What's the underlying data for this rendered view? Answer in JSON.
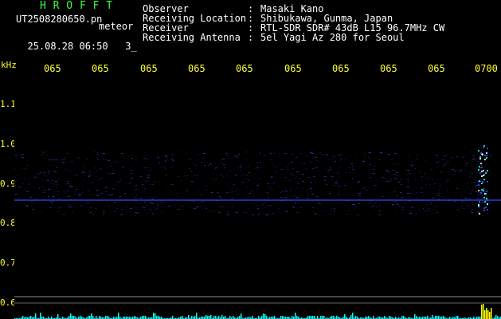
{
  "header": {
    "title": "H R O F F T",
    "filename": "UT2508280650.pn",
    "meteor_label": "meteor",
    "date_time": "25.08.28 06:50",
    "count": "3_"
  },
  "info": {
    "rows": [
      {
        "label": "Observer",
        "value": "Masaki Kano"
      },
      {
        "label": "Receiving Location",
        "value": "Shibukawa, Gunma, Japan"
      },
      {
        "label": "Receiver",
        "value": "RTL-SDR SDR# 43dB L15 96.7MHz CW"
      },
      {
        "label": "Receiving Antenna",
        "value": "5el Yagi Az 280 for Seoul"
      }
    ],
    "separator": ":"
  },
  "axis": {
    "y_unit": "kHz",
    "y_ticks": [
      "1.1",
      "1.0",
      "0.9",
      "0.8",
      "0.7",
      "0.6"
    ],
    "x_ticks": [
      "065",
      "065",
      "065",
      "065",
      "065",
      "065",
      "065",
      "065",
      "065",
      "0700"
    ]
  },
  "colors": {
    "title": "#3aff3a",
    "axis_text": "#ffff33",
    "background": "#000000",
    "signal": "#3a4cff",
    "baseline_noise": "#00ffff",
    "meteor": "#ffff00"
  }
}
